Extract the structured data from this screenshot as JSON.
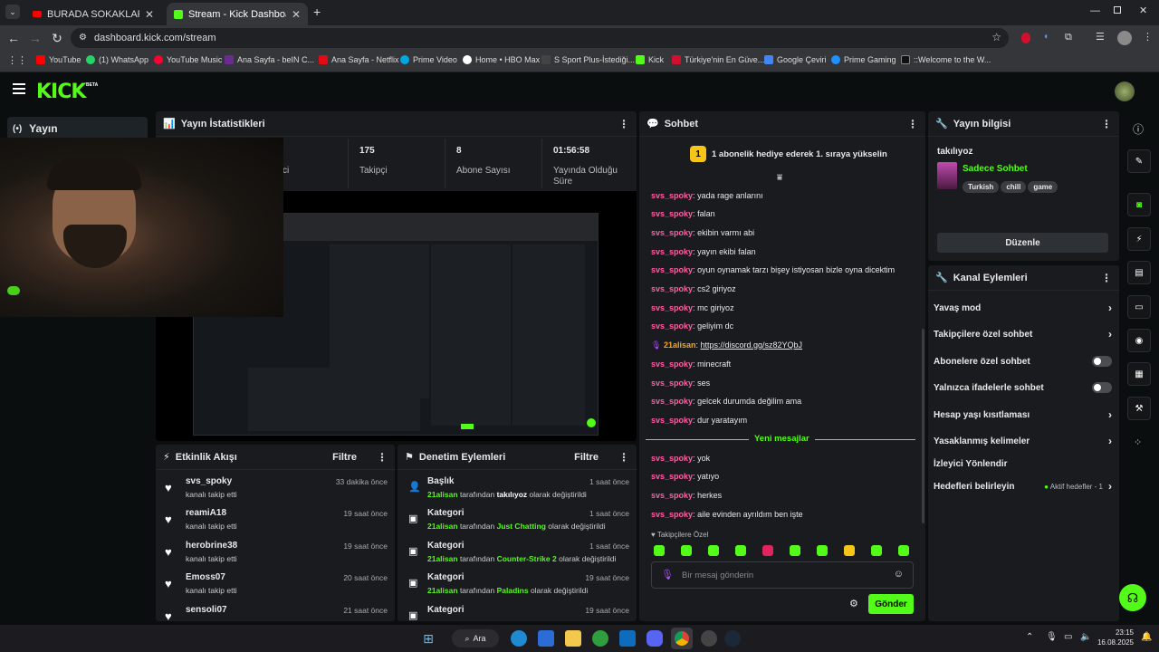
{
  "browser": {
    "tabs": [
      {
        "title": "BURADA SOKAKLAR - BATUFLE"
      },
      {
        "title": "Stream - Kick Dashboard"
      }
    ],
    "new_tab": "+",
    "url": "dashboard.kick.com/stream",
    "bookmarks": [
      {
        "label": "YouTube",
        "color": "#ff0000"
      },
      {
        "label": "(1) WhatsApp",
        "color": "#25d366"
      },
      {
        "label": "YouTube Music",
        "color": "#ff0033"
      },
      {
        "label": "Ana Sayfa - beIN C...",
        "color": "#6b2c91"
      },
      {
        "label": "Ana Sayfa - Netflix",
        "color": "#e50914"
      },
      {
        "label": "Prime Video",
        "color": "#00a8e1"
      },
      {
        "label": "Home • HBO Max",
        "color": "#ffffff"
      },
      {
        "label": "S Sport Plus-İstediği...",
        "color": "#222222"
      },
      {
        "label": "Kick",
        "color": "#53fc18"
      },
      {
        "label": "Türkiye'nin En Güve...",
        "color": "#d0102e"
      },
      {
        "label": "Google Çeviri",
        "color": "#4285f4"
      },
      {
        "label": "Prime Gaming",
        "color": "#1e90ff"
      },
      {
        "label": "::Welcome to the W...",
        "color": "#111111"
      }
    ]
  },
  "kick": {
    "logo": "KICK",
    "beta": "BETA",
    "nav": {
      "label": "Yayın"
    }
  },
  "stats": {
    "title": "Yayın İstatistikleri",
    "items": [
      {
        "value": "",
        "label": "ci"
      },
      {
        "value": "175",
        "label": "Takipçi"
      },
      {
        "value": "8",
        "label": "Abone Sayısı"
      },
      {
        "value": "01:56:58",
        "label": "Yayında Olduğu Süre"
      }
    ]
  },
  "activity": {
    "title": "Etkinlik Akışı",
    "filter": "Filtre",
    "rows": [
      {
        "name": "svs_spoky",
        "sub": "kanalı takip etti",
        "time": "33 dakika önce"
      },
      {
        "name": "reamiA18",
        "sub": "kanalı takip etti",
        "time": "19 saat önce"
      },
      {
        "name": "herobrine38",
        "sub": "kanalı takip etti",
        "time": "19 saat önce"
      },
      {
        "name": "Emoss07",
        "sub": "kanalı takip etti",
        "time": "20 saat önce"
      },
      {
        "name": "sensoli07",
        "sub": "",
        "time": "21 saat önce"
      }
    ]
  },
  "moderation": {
    "title": "Denetim Eylemleri",
    "filter": "Filtre",
    "by": "tarafından",
    "suffix": "olarak değiştirildi",
    "rows": [
      {
        "type": "Başlık",
        "user": "21alisan",
        "value": "takılıyoz",
        "time": "1 saat önce"
      },
      {
        "type": "Kategori",
        "user": "21alisan",
        "value": "Just Chatting",
        "time": "1 saat önce"
      },
      {
        "type": "Kategori",
        "user": "21alisan",
        "value": "Counter-Strike 2",
        "time": "1 saat önce"
      },
      {
        "type": "Kategori",
        "user": "21alisan",
        "value": "Paladins",
        "time": "19 saat önce"
      },
      {
        "type": "Kategori",
        "user": "",
        "value": "",
        "time": "19 saat önce"
      }
    ]
  },
  "chat": {
    "title": "Sohbet",
    "banner": "1 abonelik hediye ederek 1. sıraya yükselin",
    "banner_badge": "1",
    "messages": [
      {
        "user": "svs_spoky",
        "text": "yada rage anlarını"
      },
      {
        "user": "svs_spoky",
        "text": "falan"
      },
      {
        "user": "svs_spoky",
        "text": "ekibin varmı abi"
      },
      {
        "user": "svs_spoky",
        "text": "yayın ekibi falan"
      },
      {
        "user": "svs_spoky",
        "text": "oyun oynamak tarzı bişey istiyosan bizle oyna dicektim"
      },
      {
        "user": "svs_spoky",
        "text": "cs2 giriyoz"
      },
      {
        "user": "svs_spoky",
        "text": "mc giriyoz"
      },
      {
        "user": "svs_spoky",
        "text": "geliyim dc"
      },
      {
        "user": "21alisan",
        "text": "https://discord.gg/sz82YQbJ"
      },
      {
        "user": "svs_spoky",
        "text": "minecraft"
      },
      {
        "user": "svs_spoky",
        "text": "ses"
      },
      {
        "user": "svs_spoky",
        "text": "gelcek durumda değilim ama"
      },
      {
        "user": "svs_spoky",
        "text": "dur yaratayım"
      }
    ],
    "new_messages": "Yeni mesajlar",
    "messages_new": [
      {
        "user": "svs_spoky",
        "text": "yok"
      },
      {
        "user": "svs_spoky",
        "text": "yatıyo"
      },
      {
        "user": "svs_spoky",
        "text": "herkes"
      },
      {
        "user": "svs_spoky",
        "text": "aile evinden ayrıldım ben işte"
      }
    ],
    "followers_only": "Takipçilere Özel",
    "input_placeholder": "Bir mesaj gönderin",
    "send": "Gönder"
  },
  "stream_info": {
    "title": "Yayın bilgisi",
    "stream_title": "takılıyoz",
    "category": "Sadece Sohbet",
    "tags": [
      "Turkish",
      "chill",
      "game"
    ],
    "edit": "Düzenle"
  },
  "channel_actions": {
    "title": "Kanal Eylemleri",
    "slow": "Yavaş mod",
    "followers": "Takipçilere özel sohbet",
    "subs": "Abonelere özel sohbet",
    "emotes": "Yalnızca ifadelerle sohbet",
    "age": "Hesap yaşı kısıtlaması",
    "banned": "Yasaklanmış kelimeler",
    "redirect": "İzleyici Yönlendir",
    "goals": "Hedefleri belirleyin",
    "goals_status": "Aktif hedefler - 1"
  },
  "taskbar": {
    "search": "Ara",
    "time": "23:15",
    "date": "16.08.2025"
  }
}
